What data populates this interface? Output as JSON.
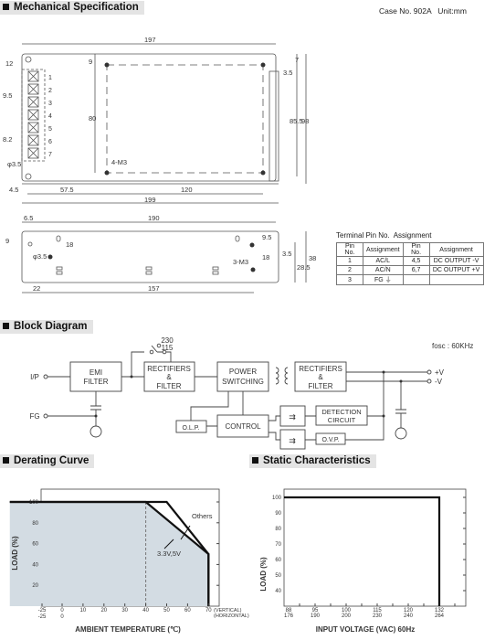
{
  "sections": {
    "mechanical": "Mechanical Specification",
    "block": "Block Diagram",
    "derating": "Derating Curve",
    "static": "Static Characteristics"
  },
  "case_info": "Case No. 902A   Unit:mm",
  "top_view": {
    "dims": [
      "197",
      "12",
      "9",
      "9.5",
      "8.2",
      "80",
      "85.5",
      "98",
      "7",
      "3.5",
      "4-M3",
      "φ3.5",
      "4.5",
      "57.5",
      "120",
      "199"
    ],
    "pins": [
      "1",
      "2",
      "3",
      "4",
      "5",
      "6",
      "7"
    ]
  },
  "side_view": {
    "dims": [
      "6.5",
      "190",
      "9",
      "φ3.5",
      "18",
      "9.5",
      "18",
      "3.5",
      "28.5",
      "38",
      "3-M3",
      "22",
      "157"
    ]
  },
  "pin_table": {
    "title": "Terminal Pin No.  Assignment",
    "headers": [
      "Pin No.",
      "Assignment",
      "Pin No.",
      "Assignment"
    ],
    "rows": [
      [
        "1",
        "AC/L",
        "4,5",
        "DC OUTPUT -V"
      ],
      [
        "2",
        "AC/N",
        "6,7",
        "DC OUTPUT +V"
      ],
      [
        "3",
        "FG ⏚",
        "",
        ""
      ]
    ]
  },
  "block_diagram": {
    "fosc": "fosc : 60KHz",
    "switch_230": "230",
    "switch_115": "115",
    "input": "I/P",
    "fg": "FG",
    "out_pos": "+V",
    "out_neg": "-V",
    "emi": [
      "EMI",
      "FILTER"
    ],
    "rect1": [
      "RECTIFIERS",
      "&",
      "FILTER"
    ],
    "power": [
      "POWER",
      "SWITCHING"
    ],
    "rect2": [
      "RECTIFIERS",
      "&",
      "FILTER"
    ],
    "olp": "O.L.P.",
    "control": "CONTROL",
    "detection": [
      "DETECTION",
      "CIRCUIT"
    ],
    "ovp": "O.V.P."
  },
  "chart_data": [
    {
      "type": "line",
      "title": "Derating Curve",
      "xlabel": "AMBIENT TEMPERATURE (℃)",
      "ylabel": "LOAD (%)",
      "x_ticks_vertical": [
        "-25",
        "0",
        "10",
        "20",
        "30",
        "40",
        "50",
        "60",
        "70"
      ],
      "x_ticks_horizontal": [
        "-25",
        "0"
      ],
      "x_tick_suffix": [
        "(VERTICAL)",
        "(HORIZONTAL)"
      ],
      "y_ticks": [
        "20",
        "40",
        "60",
        "80",
        "100"
      ],
      "xlim": [
        -25,
        77
      ],
      "ylim": [
        0,
        110
      ],
      "series": [
        {
          "name": "Others",
          "x": [
            -25,
            50,
            70,
            70
          ],
          "y": [
            100,
            100,
            50,
            0
          ]
        },
        {
          "name": "3.3V,5V",
          "x": [
            -25,
            40,
            70,
            70
          ],
          "y": [
            100,
            100,
            50,
            0
          ]
        }
      ],
      "shaded": true,
      "reference_line_x": 40,
      "colors": {
        "fill": "#d3dce3",
        "line": "#111111"
      }
    },
    {
      "type": "line",
      "title": "Static Characteristics",
      "xlabel": "INPUT VOLTAGE (VAC) 60Hz",
      "ylabel": "LOAD (%)",
      "x_ticks": [
        [
          "88",
          "176"
        ],
        [
          "95",
          "190"
        ],
        [
          "100",
          "200"
        ],
        [
          "115",
          "230"
        ],
        [
          "120",
          "240"
        ],
        [
          "132",
          "264"
        ]
      ],
      "y_ticks": [
        "40",
        "50",
        "60",
        "70",
        "80",
        "90",
        "100"
      ],
      "ylim": [
        30,
        105
      ],
      "series": [
        {
          "x": [
            "88",
            "132",
            "132"
          ],
          "y": [
            100,
            100,
            30
          ]
        }
      ],
      "colors": {
        "line": "#111111"
      }
    }
  ]
}
